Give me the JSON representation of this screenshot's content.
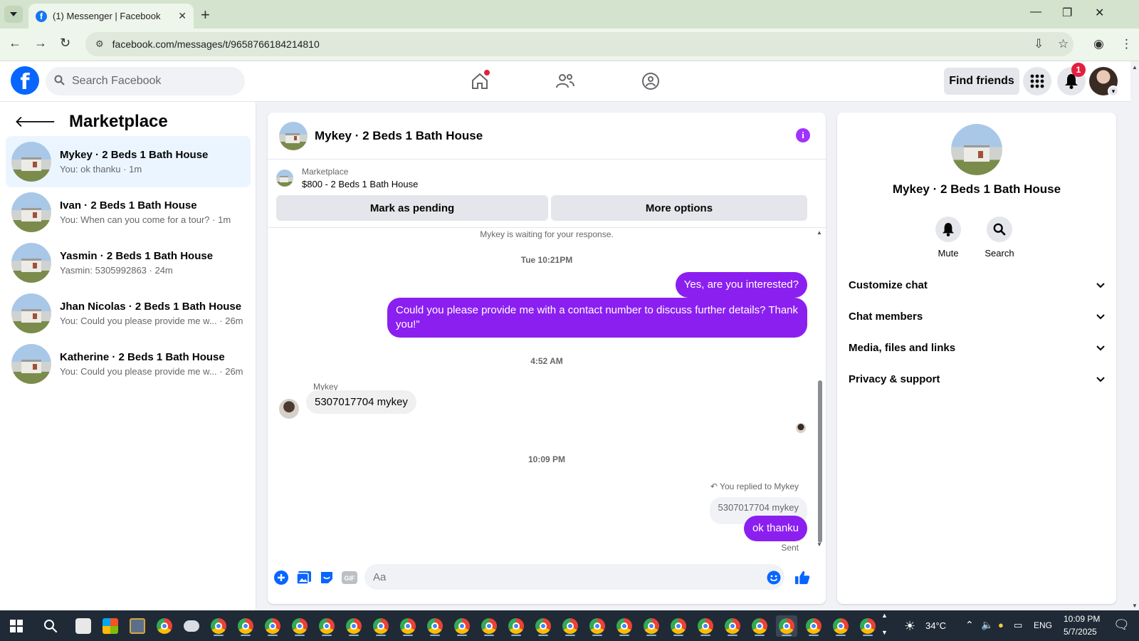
{
  "browser": {
    "tab_title": "(1) Messenger | Facebook",
    "url": "facebook.com/messages/t/9658766184214810"
  },
  "fb_header": {
    "search_placeholder": "Search Facebook",
    "find_friends_label": "Find friends",
    "notification_count": "1"
  },
  "sidebar": {
    "title": "Marketplace",
    "conversations": [
      {
        "name": "Mykey · 2 Beds 1 Bath House",
        "snippet": "You: ok thanku · 1m"
      },
      {
        "name": "Ivan · 2 Beds 1 Bath House",
        "snippet": "You: When can you come for a tour? · 1m"
      },
      {
        "name": "Yasmin · 2 Beds 1 Bath House",
        "snippet": "Yasmin: 5305992863 · 24m"
      },
      {
        "name": "Jhan Nicolas · 2 Beds 1 Bath House",
        "snippet": "You: Could you please provide me w... · 26m"
      },
      {
        "name": "Katherine · 2 Beds 1 Bath House",
        "snippet": "You: Could you please provide me w... · 26m"
      }
    ]
  },
  "chat": {
    "title": "Mykey · 2 Beds 1 Bath House",
    "listing_source": "Marketplace",
    "listing_title": "$800 - 2 Beds 1 Bath House",
    "mark_pending_label": "Mark as pending",
    "more_options_label": "More options",
    "waiting_notice": "Mykey is waiting for your response.",
    "ts1": "Tue 10:21PM",
    "msg_out_1": "Yes, are you interested?",
    "msg_out_2": "Could you please provide me with a contact number to discuss further details? Thank you!\"",
    "ts2": "4:52 AM",
    "sender_name": "Mykey",
    "msg_in_1": "5307017704 mykey",
    "ts3": "10:09 PM",
    "reply_label": "You replied to Mykey",
    "reply_quote": "5307017704 mykey",
    "msg_out_3": "ok thanku",
    "sent_status": "Sent",
    "composer_placeholder": "Aa"
  },
  "right_panel": {
    "name": "Mykey · 2 Beds 1 Bath House",
    "mute_label": "Mute",
    "search_label": "Search",
    "sections": [
      "Customize chat",
      "Chat members",
      "Media, files and links",
      "Privacy & support"
    ]
  },
  "taskbar": {
    "temperature": "34°C",
    "language": "ENG",
    "time": "10:09 PM",
    "date": "5/7/2025"
  },
  "colors": {
    "accent_purple": "#8b1ff0",
    "fb_blue": "#0866ff",
    "active_conv_bg": "#ebf5ff"
  }
}
